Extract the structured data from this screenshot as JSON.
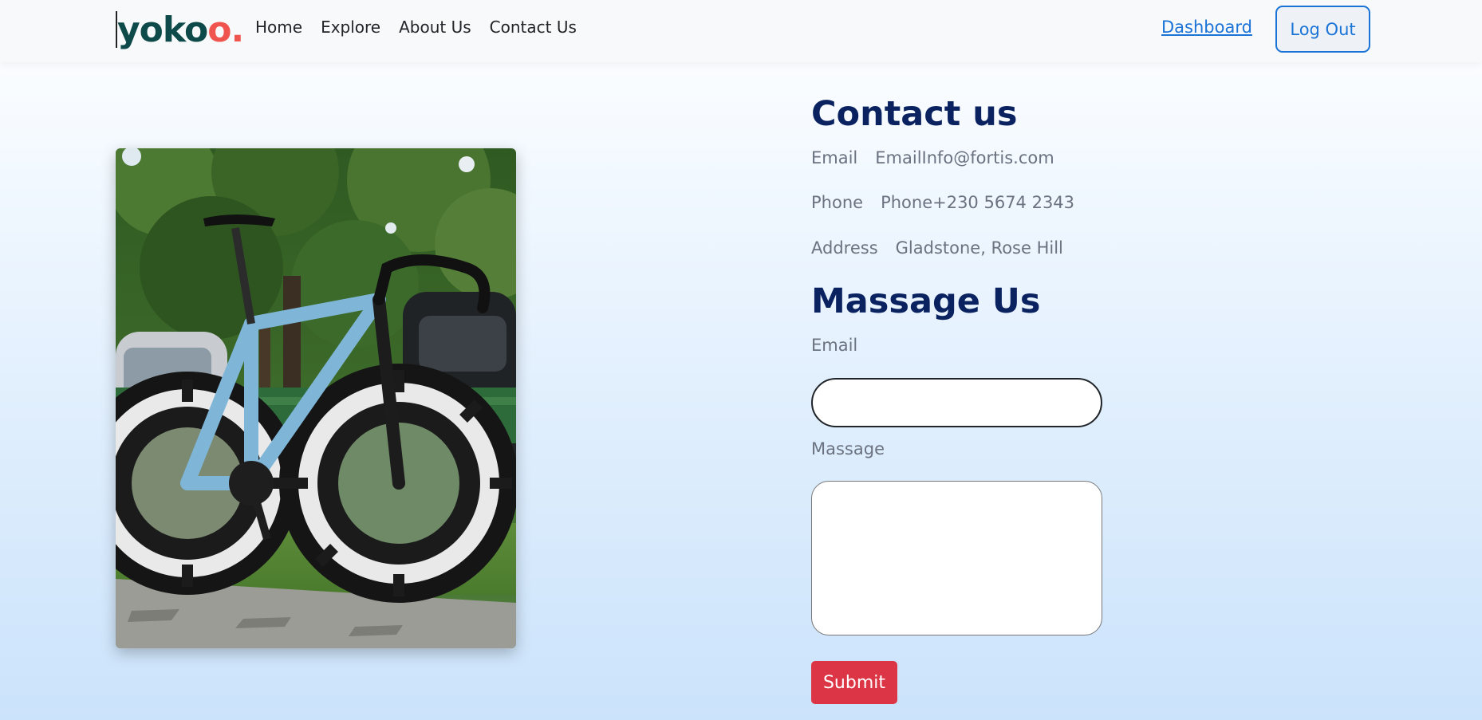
{
  "navbar": {
    "brand": {
      "part1": "yoko",
      "part2": "o",
      "dot": "."
    },
    "links": [
      "Home",
      "Explore",
      "About Us",
      "Contact Us"
    ],
    "dashboard_label": "Dashboard",
    "logout_label": "Log Out"
  },
  "contact": {
    "title": "Contact us",
    "email_label": "Email",
    "email_value": "EmailInfo@fortis.com",
    "phone_label": "Phone",
    "phone_value": "Phone+230 5674 2343",
    "address_label": "Address",
    "address_value": "Gladstone, Rose Hill"
  },
  "message_form": {
    "title": "Massage Us",
    "email_label": "Email",
    "email_value": "",
    "message_label": "Massage",
    "message_value": "",
    "submit_label": "Submit"
  },
  "colors": {
    "heading": "#0a2260",
    "link": "#1a73d6",
    "submit": "#dc3545",
    "brand_dark": "#0f4a4a",
    "brand_accent": "#f0544f"
  },
  "image": {
    "subject": "road-bicycle-photo"
  }
}
